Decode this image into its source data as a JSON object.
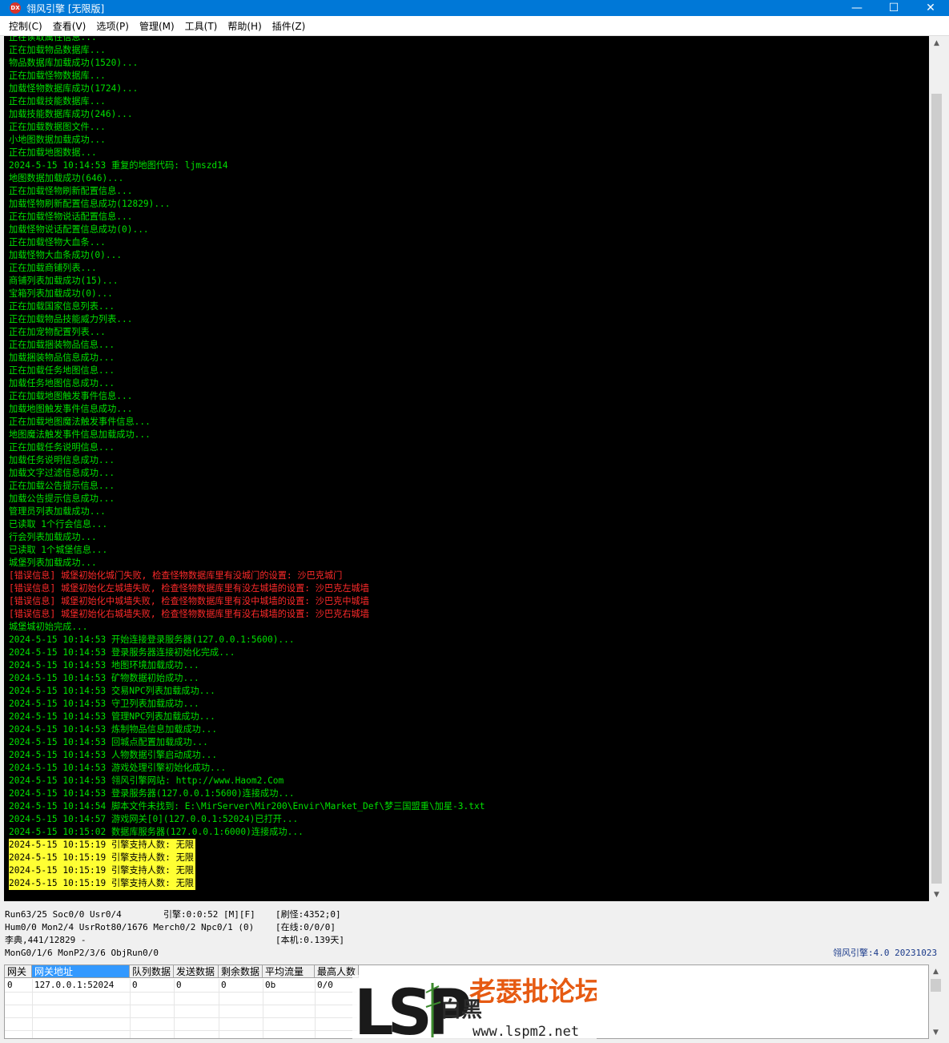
{
  "window": {
    "icon_text": "DX",
    "title": "翎风引擎 [无限版]",
    "minimize": "—",
    "maximize": "☐",
    "close": "✕"
  },
  "menu": [
    "控制(C)",
    "查看(V)",
    "选项(P)",
    "管理(M)",
    "工具(T)",
    "帮助(H)",
    "插件(Z)"
  ],
  "log": [
    {
      "text": "正在读取属性信息...",
      "type": "normal"
    },
    {
      "text": "正在加载物品数据库...",
      "type": "normal"
    },
    {
      "text": "物品数据库加载成功(1520)...",
      "type": "normal"
    },
    {
      "text": "正在加载怪物数据库...",
      "type": "normal"
    },
    {
      "text": "加载怪物数据库成功(1724)...",
      "type": "normal"
    },
    {
      "text": "正在加载技能数据库...",
      "type": "normal"
    },
    {
      "text": "加载技能数据库成功(246)...",
      "type": "normal"
    },
    {
      "text": "正在加载数据图文件...",
      "type": "normal"
    },
    {
      "text": "小地图数据加载成功...",
      "type": "normal"
    },
    {
      "text": "正在加载地图数据...",
      "type": "normal"
    },
    {
      "text": "2024-5-15 10:14:53 重复的地图代码: ljmszd14",
      "type": "normal"
    },
    {
      "text": "地图数据加载成功(646)...",
      "type": "normal"
    },
    {
      "text": "正在加载怪物刷新配置信息...",
      "type": "normal"
    },
    {
      "text": "加载怪物刷新配置信息成功(12829)...",
      "type": "normal"
    },
    {
      "text": "正在加载怪物说话配置信息...",
      "type": "normal"
    },
    {
      "text": "加载怪物说话配置信息成功(0)...",
      "type": "normal"
    },
    {
      "text": "正在加载怪物大血条...",
      "type": "normal"
    },
    {
      "text": "加载怪物大血条成功(0)...",
      "type": "normal"
    },
    {
      "text": "正在加载商铺列表...",
      "type": "normal"
    },
    {
      "text": "商铺列表加载成功(15)...",
      "type": "normal"
    },
    {
      "text": "宝箱列表加载成功(0)...",
      "type": "normal"
    },
    {
      "text": "正在加载国家信息列表...",
      "type": "normal"
    },
    {
      "text": "正在加载物品技能威力列表...",
      "type": "normal"
    },
    {
      "text": "正在加宠物配置列表...",
      "type": "normal"
    },
    {
      "text": "正在加载捆装物品信息...",
      "type": "normal"
    },
    {
      "text": "加载捆装物品信息成功...",
      "type": "normal"
    },
    {
      "text": "正在加载任务地图信息...",
      "type": "normal"
    },
    {
      "text": "加载任务地图信息成功...",
      "type": "normal"
    },
    {
      "text": "正在加载地图触发事件信息...",
      "type": "normal"
    },
    {
      "text": "加载地图触发事件信息成功...",
      "type": "normal"
    },
    {
      "text": "正在加载地图魔法触发事件信息...",
      "type": "normal"
    },
    {
      "text": "地图魔法触发事件信息加载成功...",
      "type": "normal"
    },
    {
      "text": "正在加载任务说明信息...",
      "type": "normal"
    },
    {
      "text": "加载任务说明信息成功...",
      "type": "normal"
    },
    {
      "text": "加载文字过滤信息成功...",
      "type": "normal"
    },
    {
      "text": "正在加载公告提示信息...",
      "type": "normal"
    },
    {
      "text": "加载公告提示信息成功...",
      "type": "normal"
    },
    {
      "text": "管理员列表加载成功...",
      "type": "normal"
    },
    {
      "text": "已读取 1个行会信息...",
      "type": "normal"
    },
    {
      "text": "行会列表加载成功...",
      "type": "normal"
    },
    {
      "text": "已读取 1个城堡信息...",
      "type": "normal"
    },
    {
      "text": "城堡列表加载成功...",
      "type": "normal"
    },
    {
      "text": "[错误信息] 城堡初始化城门失败, 检查怪物数据库里有没城门的设置: 沙巴克城门",
      "type": "error"
    },
    {
      "text": "[错误信息] 城堡初始化左城墙失败, 检查怪物数据库里有没左城墙的设置: 沙巴克左城墙",
      "type": "error"
    },
    {
      "text": "[错误信息] 城堡初始化中城墙失败, 检查怪物数据库里有没中城墙的设置: 沙巴克中城墙",
      "type": "error"
    },
    {
      "text": "[错误信息] 城堡初始化右城墙失败, 检查怪物数据库里有没右城墙的设置: 沙巴克右城墙",
      "type": "error"
    },
    {
      "text": "城堡城初始完成...",
      "type": "normal"
    },
    {
      "text": "2024-5-15 10:14:53 开始连接登录服务器(127.0.0.1:5600)...",
      "type": "normal"
    },
    {
      "text": "2024-5-15 10:14:53 登录服务器连接初始化完成...",
      "type": "normal"
    },
    {
      "text": "2024-5-15 10:14:53 地图环境加载成功...",
      "type": "normal"
    },
    {
      "text": "2024-5-15 10:14:53 矿物数据初始成功...",
      "type": "normal"
    },
    {
      "text": "2024-5-15 10:14:53 交易NPC列表加载成功...",
      "type": "normal"
    },
    {
      "text": "2024-5-15 10:14:53 守卫列表加载成功...",
      "type": "normal"
    },
    {
      "text": "2024-5-15 10:14:53 管理NPC列表加载成功...",
      "type": "normal"
    },
    {
      "text": "2024-5-15 10:14:53 炼制物品信息加载成功...",
      "type": "normal"
    },
    {
      "text": "2024-5-15 10:14:53 回城点配置加载成功...",
      "type": "normal"
    },
    {
      "text": "2024-5-15 10:14:53 人物数据引擎启动成功...",
      "type": "normal"
    },
    {
      "text": "2024-5-15 10:14:53 游戏处理引擎初始化成功...",
      "type": "normal"
    },
    {
      "text": "2024-5-15 10:14:53 翎风引擎网站: http://www.Haom2.Com",
      "type": "normal"
    },
    {
      "text": "2024-5-15 10:14:53 登录服务器(127.0.0.1:5600)连接成功...",
      "type": "normal"
    },
    {
      "text": "2024-5-15 10:14:54 脚本文件未找到: E:\\MirServer\\Mir200\\Envir\\Market_Def\\梦三国盟重\\加星-3.txt",
      "type": "normal"
    },
    {
      "text": "2024-5-15 10:14:57 游戏网关[0](127.0.0.1:52024)已打开...",
      "type": "normal"
    },
    {
      "text": "2024-5-15 10:15:02 数据库服务器(127.0.0.1:6000)连接成功...",
      "type": "normal"
    },
    {
      "text": "2024-5-15 10:15:19 引擎支持人数: 无限",
      "type": "hl"
    },
    {
      "text": "2024-5-15 10:15:19 引擎支持人数: 无限",
      "type": "hl"
    },
    {
      "text": "2024-5-15 10:15:19 引擎支持人数: 无限",
      "type": "hl"
    },
    {
      "text": "2024-5-15 10:15:19 引擎支持人数: 无限",
      "type": "hl"
    }
  ],
  "status": {
    "run": "Run63/25 Soc0/0 Usr0/4",
    "engine": "引擎:0:0:52 [M][F]",
    "refresh": "[刷怪:4352;0]",
    "hum": "Hum0/0 Mon2/4 UsrRot80/1676 Merch0/2 Npc0/1 (0)",
    "online": "[在线:0/0/0]",
    "dict": "李典,441/12829 -",
    "local": "[本机:0.139天]",
    "mon": "MonG0/1/6 MonP2/3/6 ObjRun0/0",
    "version": "翎风引擎:4.0 20231023"
  },
  "gateway": {
    "headers": [
      "网关",
      "网关地址",
      "队列数据",
      "发送数据",
      "剩余数据",
      "平均流量",
      "最高人数"
    ],
    "rows": [
      [
        "0",
        "127.0.0.1:52024",
        "0",
        "0",
        "0",
        "0b",
        "0/0"
      ]
    ]
  },
  "watermark": {
    "brand": "LSP",
    "site_cn": "老瑟批论坛",
    "sub_cn": "白黑",
    "url": "www.lspm2.net"
  }
}
